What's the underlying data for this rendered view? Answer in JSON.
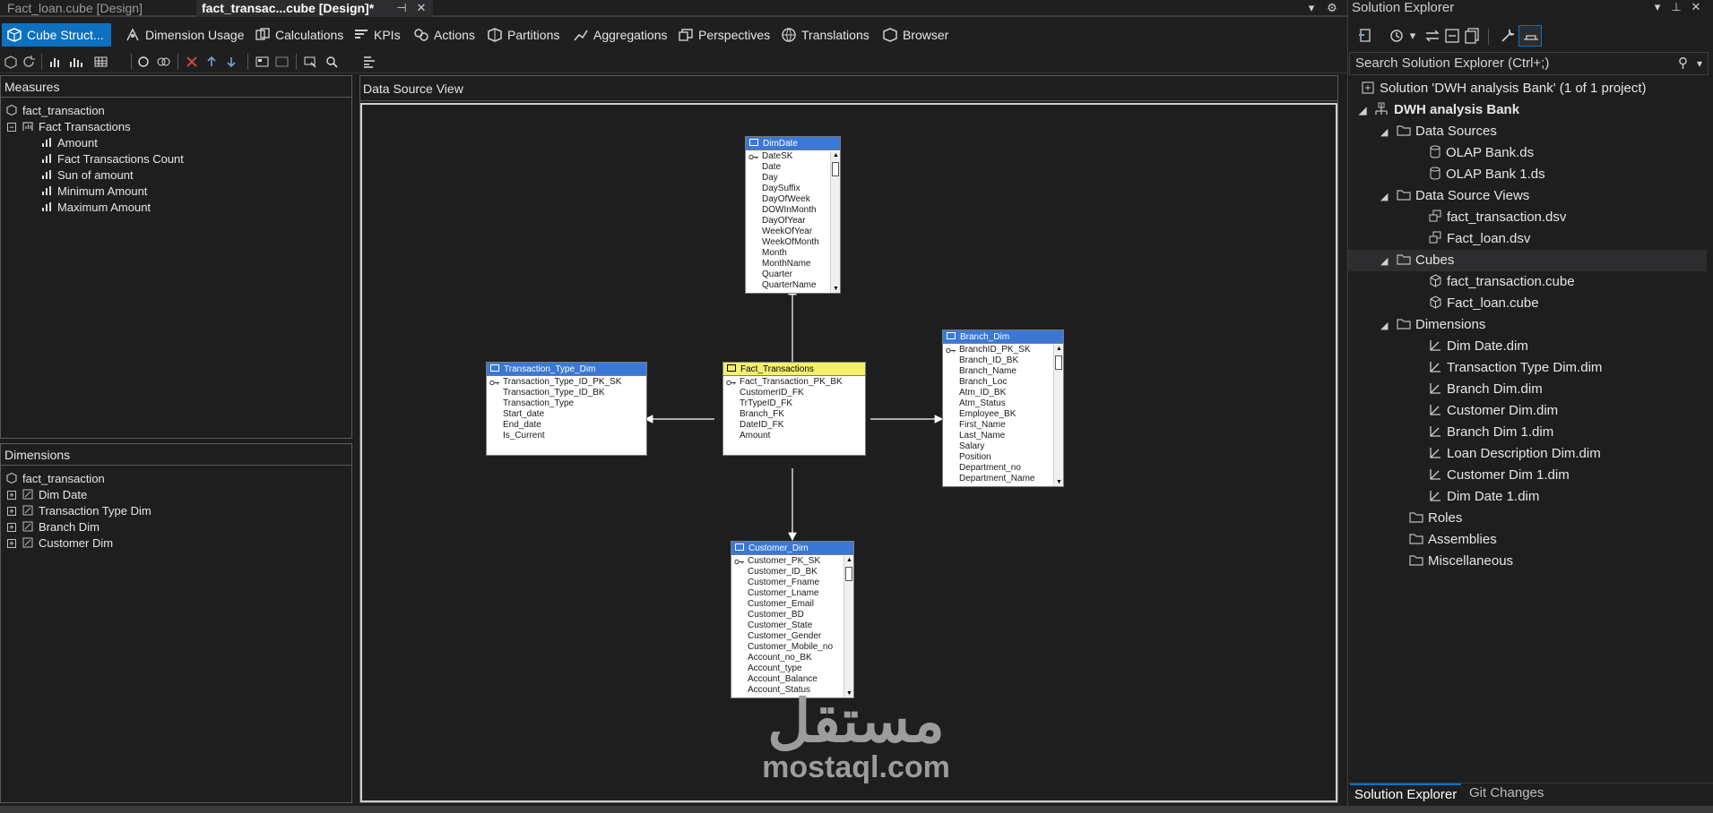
{
  "doc_tabs": [
    {
      "label": "Fact_loan.cube [Design]",
      "active": false
    },
    {
      "label": "fact_transac...cube [Design]*",
      "active": true
    }
  ],
  "designer_tabs": [
    {
      "label": "Cube Struct...",
      "icon": "cube-structure-icon",
      "active": true
    },
    {
      "label": "Dimension Usage",
      "icon": "dimension-usage-icon"
    },
    {
      "label": "Calculations",
      "icon": "calculations-icon"
    },
    {
      "label": "KPIs",
      "icon": "kpis-icon"
    },
    {
      "label": "Actions",
      "icon": "actions-icon"
    },
    {
      "label": "Partitions",
      "icon": "partitions-icon"
    },
    {
      "label": "Aggregations",
      "icon": "aggregations-icon"
    },
    {
      "label": "Perspectives",
      "icon": "perspectives-icon"
    },
    {
      "label": "Translations",
      "icon": "translations-icon"
    },
    {
      "label": "Browser",
      "icon": "browser-icon"
    }
  ],
  "measures": {
    "title": "Measures",
    "cube": "fact_transaction",
    "group": "Fact Transactions",
    "items": [
      "Amount",
      "Fact Transactions Count",
      "Sun of amount",
      "Minimum Amount",
      "Maximum Amount"
    ]
  },
  "dimensions": {
    "title": "Dimensions",
    "cube": "fact_transaction",
    "items": [
      "Dim Date",
      "Transaction Type Dim",
      "Branch Dim",
      "Customer Dim"
    ]
  },
  "dsv": {
    "title": "Data Source View",
    "tables": {
      "dimdate": {
        "name": "DimDate",
        "columns": [
          "DateSK",
          "Date",
          "Day",
          "DaySuffix",
          "DayOfWeek",
          "DOWInMonth",
          "DayOfYear",
          "WeekOfYear",
          "WeekOfMonth",
          "Month",
          "MonthName",
          "Quarter",
          "QuarterName"
        ]
      },
      "transtype": {
        "name": "Transaction_Type_Dim",
        "columns": [
          "Transaction_Type_ID_PK_SK",
          "Transaction_Type_ID_BK",
          "Transaction_Type",
          "Start_date",
          "End_date",
          "Is_Current"
        ]
      },
      "fact": {
        "name": "Fact_Transactions",
        "columns": [
          "Fact_Transaction_PK_BK",
          "CustomerID_FK",
          "TrTypeID_FK",
          "Branch_FK",
          "DateID_FK",
          "Amount"
        ]
      },
      "branch": {
        "name": "Branch_Dim",
        "columns": [
          "BranchID_PK_SK",
          "Branch_ID_BK",
          "Branch_Name",
          "Branch_Loc",
          "Atm_ID_BK",
          "Atm_Status",
          "Employee_BK",
          "First_Name",
          "Last_Name",
          "Salary",
          "Position",
          "Department_no",
          "Department_Name"
        ]
      },
      "customer": {
        "name": "Customer_Dim",
        "columns": [
          "Customer_PK_SK",
          "Customer_ID_BK",
          "Customer_Fname",
          "Customer_Lname",
          "Customer_Email",
          "Customer_BD",
          "Customer_State",
          "Customer_Gender",
          "Customer_Mobile_no",
          "Account_no_BK",
          "Account_type",
          "Account_Balance",
          "Account_Status"
        ]
      }
    }
  },
  "watermark": {
    "arabic": "مستقل",
    "latin": "mostaql.com"
  },
  "solution_explorer": {
    "title": "Solution Explorer",
    "search_placeholder": "Search Solution Explorer (Ctrl+;)",
    "solution": "Solution 'DWH analysis Bank' (1 of 1 project)",
    "project": "DWH analysis Bank",
    "folders": {
      "data_sources": "Data Sources",
      "data_source_views": "Data Source Views",
      "cubes": "Cubes",
      "dimensions": "Dimensions",
      "roles": "Roles",
      "assemblies": "Assemblies",
      "misc": "Miscellaneous"
    },
    "data_sources": [
      "OLAP Bank.ds",
      "OLAP Bank 1.ds"
    ],
    "data_source_views": [
      "fact_transaction.dsv",
      "Fact_loan.dsv"
    ],
    "cubes": [
      "fact_transaction.cube",
      "Fact_loan.cube"
    ],
    "dimensions": [
      "Dim Date.dim",
      "Transaction Type Dim.dim",
      "Branch Dim.dim",
      "Customer Dim.dim",
      "Branch Dim 1.dim",
      "Loan Description Dim.dim",
      "Customer Dim 1.dim",
      "Dim Date 1.dim"
    ],
    "bottom_tabs": [
      "Solution Explorer",
      "Git Changes"
    ]
  },
  "colors": {
    "accent": "#0e70c0",
    "table_header": "#3b78d6",
    "fact_header": "#f5f06b"
  }
}
